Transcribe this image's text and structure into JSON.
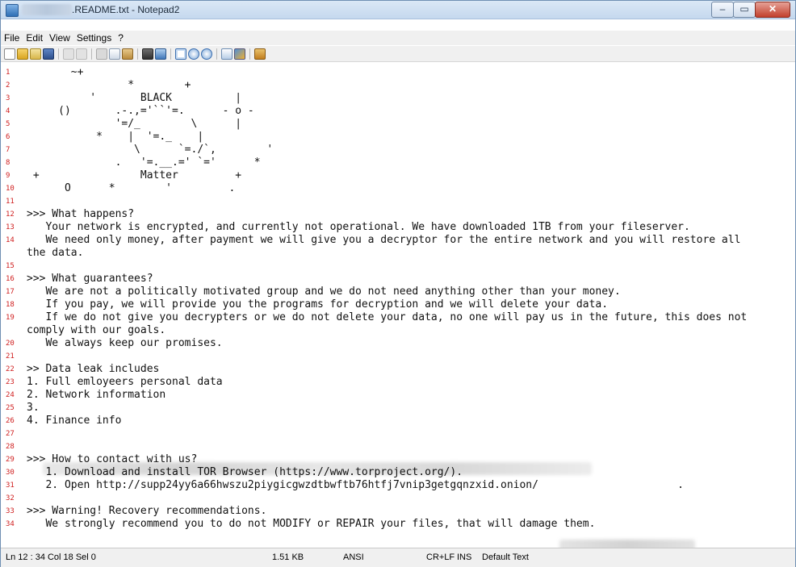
{
  "window": {
    "title": ".README.txt - Notepad2",
    "buttons": {
      "minimize": "–",
      "maximize": "▭",
      "close": "✕"
    }
  },
  "menu": [
    "File",
    "Edit",
    "View",
    "Settings",
    "?"
  ],
  "toolbar": {
    "icons": [
      "new-icon",
      "open-icon",
      "browse-icon",
      "save-icon",
      "undo-icon",
      "redo-icon",
      "cut-icon",
      "copy-icon",
      "paste-icon",
      "find-icon",
      "replace-icon",
      "word-wrap-icon",
      "zoom-in-icon",
      "zoom-out-icon",
      "scheme-icon",
      "customize-icon",
      "exit-icon"
    ]
  },
  "editor": {
    "lines": [
      {
        "n": "1",
        "t": "       ~+"
      },
      {
        "n": "2",
        "t": "                *        +"
      },
      {
        "n": "3",
        "t": "          '       BLACK          |"
      },
      {
        "n": "4",
        "t": "     ()       .-.,='``'=.      - o -"
      },
      {
        "n": "5",
        "t": "              '=/_        \\      |"
      },
      {
        "n": "6",
        "t": "           *    |  '=._    |"
      },
      {
        "n": "7",
        "t": "                 \\      `=./`,        '"
      },
      {
        "n": "8",
        "t": "              .   '=.__.=' `='      *"
      },
      {
        "n": "9",
        "t": " +                Matter         +"
      },
      {
        "n": "10",
        "t": "      O      *        '         ."
      },
      {
        "n": "11",
        "t": ""
      },
      {
        "n": "12",
        "t": ">>> What happens?"
      },
      {
        "n": "13",
        "t": "   Your network is encrypted, and currently not operational. We have downloaded 1TB from your fileserver."
      },
      {
        "n": "14",
        "t": "   We need only money, after payment we will give you a decryptor for the entire network and you will restore all"
      },
      {
        "n": "",
        "t": "the data."
      },
      {
        "n": "15",
        "t": ""
      },
      {
        "n": "16",
        "t": ">>> What guarantees?"
      },
      {
        "n": "17",
        "t": "   We are not a politically motivated group and we do not need anything other than your money."
      },
      {
        "n": "18",
        "t": "   If you pay, we will provide you the programs for decryption and we will delete your data."
      },
      {
        "n": "19",
        "t": "   If we do not give you decrypters or we do not delete your data, no one will pay us in the future, this does not"
      },
      {
        "n": "",
        "t": "comply with our goals."
      },
      {
        "n": "20",
        "t": "   We always keep our promises."
      },
      {
        "n": "21",
        "t": ""
      },
      {
        "n": "22",
        "t": ">> Data leak includes"
      },
      {
        "n": "23",
        "t": "1. Full emloyeers personal data"
      },
      {
        "n": "24",
        "t": "2. Network information"
      },
      {
        "n": "25",
        "t": "3."
      },
      {
        "n": "26",
        "t": "4. Finance info"
      },
      {
        "n": "27",
        "t": ""
      },
      {
        "n": "28",
        "t": ""
      },
      {
        "n": "29",
        "t": ">>> How to contact with us?"
      },
      {
        "n": "30",
        "t": "   1. Download and install TOR Browser (https://www.torproject.org/)."
      },
      {
        "n": "31",
        "t": "   2. Open http://supp24yy6a66hwszu2piygicgwzdtbwftb76htfj7vnip3getgqnzxid.onion/                      ."
      },
      {
        "n": "32",
        "t": ""
      },
      {
        "n": "33",
        "t": ">>> Warning! Recovery recommendations."
      },
      {
        "n": "34",
        "t": "   We strongly recommend you to do not MODIFY or REPAIR your files, that will damage them."
      }
    ]
  },
  "status": {
    "position": "Ln 12 : 34  Col 18  Sel 0",
    "size": "1.51 KB",
    "encoding": "ANSI",
    "eol": "CR+LF",
    "mode": "INS",
    "scheme": "Default Text"
  }
}
